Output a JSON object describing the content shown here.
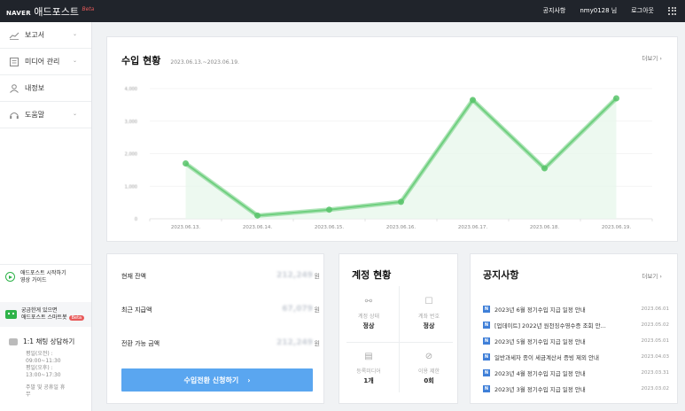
{
  "header": {
    "brand": "NAVER",
    "app_name": "애드포스트",
    "beta": "Beta",
    "notice_link": "공지사항",
    "user": "nmy0128 님",
    "logout": "로그아웃"
  },
  "sidebar": {
    "items": [
      {
        "label": "보고서",
        "icon": "chart-line-icon"
      },
      {
        "label": "미디어 관리",
        "icon": "media-icon"
      },
      {
        "label": "내정보",
        "icon": "person-icon"
      },
      {
        "label": "도움말",
        "icon": "headset-icon"
      }
    ],
    "guide_line1": "애드포스트 시작하기",
    "guide_line2": "영상 가이드",
    "bot_line1": "궁금한게 있으면",
    "bot_line2": "애드포스트 스마트봇",
    "bot_badge": "Beta",
    "chat_label": "1:1 채팅 상담하기",
    "hours": [
      "평일(오전) :",
      "09:00~11:30",
      "평일(오후) :",
      "13:00~17:30",
      "",
      "주말 및 공휴일 휴",
      "무"
    ]
  },
  "revenue": {
    "title": "수입 현황",
    "range": "2023.06.13.~2023.06.19.",
    "more": "더보기  ›"
  },
  "chart_data": {
    "type": "area",
    "x": [
      "2023.06.13.",
      "2023.06.14.",
      "2023.06.15.",
      "2023.06.16.",
      "2023.06.17.",
      "2023.06.18.",
      "2023.06.19."
    ],
    "series": [
      {
        "values": [
          1700,
          100,
          280,
          520,
          3650,
          1550,
          3700
        ]
      }
    ],
    "ylim": [
      0,
      4000
    ],
    "yticks": [
      0,
      1000,
      2000,
      3000,
      4000
    ],
    "ytick_labels": [
      "0",
      "1,000",
      "2,000",
      "3,000",
      "4,000"
    ],
    "color": "#6fcf7f",
    "grid": true
  },
  "balance": {
    "rows": [
      {
        "label": "현재 잔액",
        "value": "212,249",
        "unit": "원"
      },
      {
        "label": "최근 지급액",
        "value": "67,079",
        "unit": "원"
      },
      {
        "label": "전환 가능 금액",
        "value": "212,249",
        "unit": "원"
      }
    ],
    "button": "수입전환 신청하기",
    "button_arrow": "›"
  },
  "account": {
    "title": "계정 현황",
    "cells": [
      {
        "label": "계정 상태",
        "value": "정상",
        "icon": "person-icon"
      },
      {
        "label": "계좌 번호",
        "value": "정상",
        "icon": "bank-icon"
      },
      {
        "label": "등록미디어",
        "value": "1개",
        "icon": "document-icon"
      },
      {
        "label": "이용 제한",
        "value": "0회",
        "icon": "ban-icon"
      }
    ]
  },
  "notices": {
    "title": "공지사항",
    "more": "더보기  ›",
    "badge": "N",
    "items": [
      {
        "text": "2023년 6월 정기수입 지급 일정 안내",
        "date": "2023.06.01"
      },
      {
        "text": "[업데이트] 2022년 원천징수영수증 조회 안...",
        "date": "2023.05.02"
      },
      {
        "text": "2023년 5월 정기수입 지급 일정 안내",
        "date": "2023.05.01"
      },
      {
        "text": "일반과세자 종이 세금계산서 증빙 제외 안내",
        "date": "2023.04.03"
      },
      {
        "text": "2023년 4월 정기수입 지급 일정 안내",
        "date": "2023.03.31"
      },
      {
        "text": "2023년 3월 정기수입 지급 일정 안내",
        "date": "2023.03.02"
      }
    ]
  }
}
